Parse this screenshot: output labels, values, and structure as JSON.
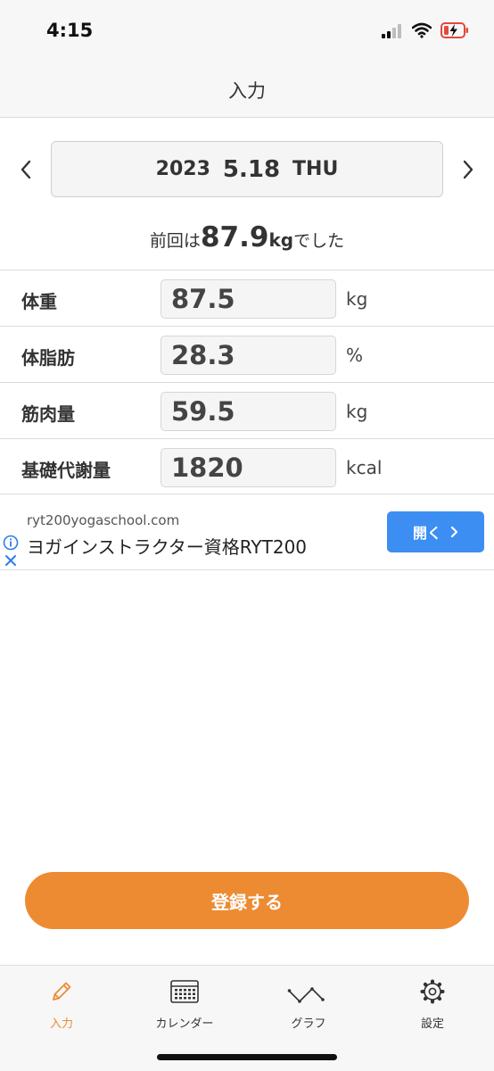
{
  "status_bar": {
    "time": "4:15"
  },
  "header": {
    "title": "入力"
  },
  "date": {
    "year": "2023",
    "month_day": "5.18",
    "weekday": "THU"
  },
  "previous": {
    "prefix": "前回は",
    "value": "87.9",
    "unit": "kg",
    "suffix": "でした"
  },
  "rows": [
    {
      "label": "体重",
      "value": "87.5",
      "unit": "kg"
    },
    {
      "label": "体脂肪",
      "value": "28.3",
      "unit": "%"
    },
    {
      "label": "筋肉量",
      "value": "59.5",
      "unit": "kg"
    },
    {
      "label": "基礎代謝量",
      "value": "1820",
      "unit": "kcal"
    }
  ],
  "ad": {
    "domain": "ryt200yogaschool.com",
    "title": "ヨガインストラクター資格RYT200",
    "open_label": "開く"
  },
  "register_label": "登録する",
  "tabs": [
    {
      "label": "入力",
      "icon": "pencil-icon",
      "active": true
    },
    {
      "label": "カレンダー",
      "icon": "calendar-icon",
      "active": false
    },
    {
      "label": "グラフ",
      "icon": "graph-icon",
      "active": false
    },
    {
      "label": "設定",
      "icon": "gear-icon",
      "active": false
    }
  ],
  "colors": {
    "accent": "#ed8b33",
    "ad_button": "#3d8ef3",
    "battery_low": "#e5483c"
  }
}
